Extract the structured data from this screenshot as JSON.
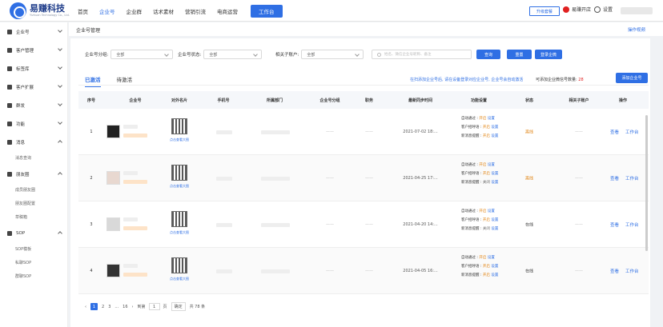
{
  "app": {
    "name": "易赚科技",
    "subtitle": "Yizhuan Technology Co., Ltd."
  },
  "topnav": {
    "items": [
      "首页",
      "企业号",
      "企业群",
      "话术素材",
      "营销引流",
      "电商运营"
    ],
    "active": "企业号",
    "work_button": "工作台"
  },
  "header_right": {
    "upgrade": "升级套餐",
    "store": "易赚开店",
    "settings": "设置"
  },
  "sidebar": {
    "items": [
      {
        "label": "企业号",
        "chevron": "down"
      },
      {
        "label": "客户管理",
        "chevron": "down"
      },
      {
        "label": "标签库",
        "chevron": "down"
      },
      {
        "label": "客户扩展",
        "chevron": "down"
      },
      {
        "label": "群发",
        "chevron": "down"
      },
      {
        "label": "功能",
        "chevron": "down"
      },
      {
        "label": "消息",
        "chevron": "up"
      },
      {
        "label": "朋友圈",
        "chevron": "up"
      },
      {
        "label": "SOP",
        "chevron": "up"
      }
    ],
    "sub_message": [
      "消息查询"
    ],
    "sub_moments": [
      "成员朋友圈",
      "朋友圈配置",
      "草稿箱"
    ],
    "sub_sop": [
      "SOP模板",
      "私聊SOP",
      "群聊SOP"
    ]
  },
  "page": {
    "title": "企业号管理",
    "video_link": "操作视频"
  },
  "filters": {
    "group_label": "企业号分组:",
    "group_value": "全部",
    "status_label": "企业号状态:",
    "status_value": "全部",
    "related_label": "相关子账户:",
    "related_value": "全部",
    "search_placeholder": "姓名、微信企业号昵称、备注",
    "query_button": "查询",
    "reset_button": "重置",
    "login_button": "登录企微"
  },
  "tabs": {
    "active": "已激活",
    "inactive": "待激活"
  },
  "notice": "在扫添加企业号后, 请在设备登录对应企业号, 企业号会自动激活",
  "quota": {
    "label": "可添加企业微信号数量:",
    "value": "28"
  },
  "add_button": "添加企业号",
  "table": {
    "headers": [
      "序号",
      "企业号",
      "对外名片",
      "手机号",
      "所属部门",
      "企业号分组",
      "职务",
      "最新同步时间",
      "功能设置",
      "状态",
      "相关子账户",
      "操作"
    ],
    "qr_link": "点击查看大图",
    "func_labels": [
      "自动通过",
      "客户招呼语",
      "新消息提醒"
    ],
    "setting_link": "设置",
    "ops": [
      "查看",
      "工作台"
    ],
    "dash": "——",
    "rows": [
      {
        "index": "1",
        "time": "2021-07-02 18:...",
        "funcs": [
          "开启",
          "开启",
          "开启"
        ],
        "status": "离线"
      },
      {
        "index": "2",
        "time": "2021-04-25 17:...",
        "funcs": [
          "开启",
          "开启",
          "关闭"
        ],
        "status": "离线"
      },
      {
        "index": "3",
        "time": "2021-04-20 14:...",
        "funcs": [
          "开启",
          "开启",
          "关闭"
        ],
        "status": "在线"
      },
      {
        "index": "4",
        "time": "2021-04-05 16:...",
        "funcs": [
          "开启",
          "开启",
          "开启"
        ],
        "status": "在线"
      }
    ]
  },
  "pager": {
    "pages": [
      "2",
      "3",
      "...",
      "16"
    ],
    "current": "1",
    "goto_label": "到第",
    "goto_value": "1",
    "page_unit": "页",
    "confirm": "确定",
    "total": "共 78 条"
  }
}
